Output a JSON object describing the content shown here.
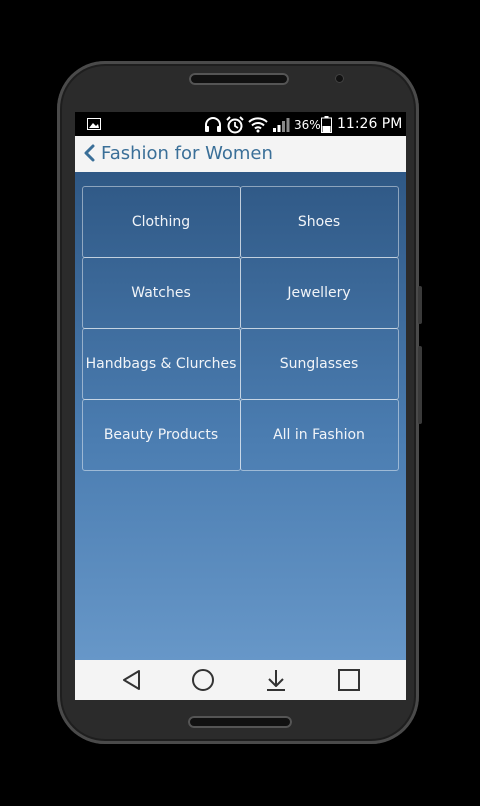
{
  "status_bar": {
    "battery_percent": "36%",
    "time": "11:26 PM",
    "icons": [
      "image-icon",
      "headphones-icon",
      "alarm-icon",
      "wifi-icon",
      "signal-icon",
      "battery-icon"
    ]
  },
  "action_bar": {
    "title": "Fashion for Women"
  },
  "categories": [
    {
      "label": "Clothing"
    },
    {
      "label": "Shoes"
    },
    {
      "label": "Watches"
    },
    {
      "label": "Jewellery"
    },
    {
      "label": "Handbags & Clurches"
    },
    {
      "label": "Sunglasses"
    },
    {
      "label": "Beauty Products"
    },
    {
      "label": "All in Fashion"
    }
  ],
  "nav_bar": [
    "back-icon",
    "home-icon",
    "download-icon",
    "recents-icon"
  ],
  "colors": {
    "title": "#3a6f98",
    "content_top": "#2f5885",
    "content_bottom": "#6797c8",
    "bars": "#f4f4f4"
  }
}
